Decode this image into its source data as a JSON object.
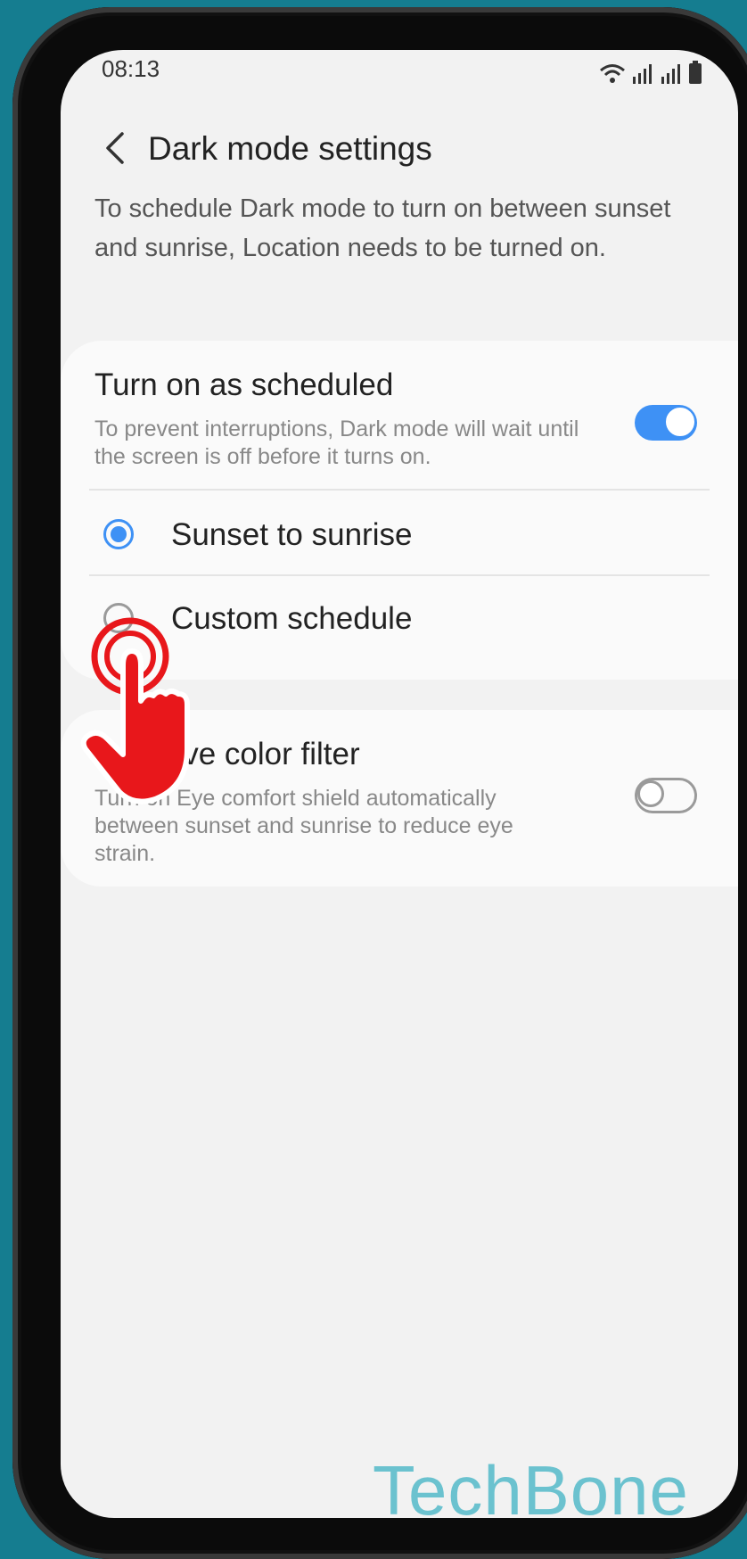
{
  "status_bar": {
    "time": "08:13",
    "icons": [
      "wifi-icon",
      "signal-icon",
      "signal-icon",
      "battery-icon"
    ]
  },
  "header": {
    "title": "Dark mode settings",
    "back_icon": "chevron-left-icon"
  },
  "description": "To schedule Dark mode to turn on between sunset and sunrise, Location needs to be turned on.",
  "schedule_card": {
    "title": "Turn on as scheduled",
    "subtitle": "To prevent interruptions, Dark mode will wait until the screen is off before it turns on.",
    "toggle_on": true,
    "options": [
      {
        "label": "Sunset to sunrise",
        "selected": true
      },
      {
        "label": "Custom schedule",
        "selected": false
      }
    ]
  },
  "filter_card": {
    "title": "Adaptive color filter",
    "subtitle": "Turn on Eye comfort shield automatically between sunset and sunrise to reduce eye strain.",
    "toggle_on": false
  },
  "overlay": {
    "icon": "tap-hand-icon",
    "color": "#e8171b"
  },
  "watermark": "TechBone",
  "colors": {
    "accent": "#3e91f5",
    "background": "#157d90",
    "watermark": "#6bc2cf"
  }
}
